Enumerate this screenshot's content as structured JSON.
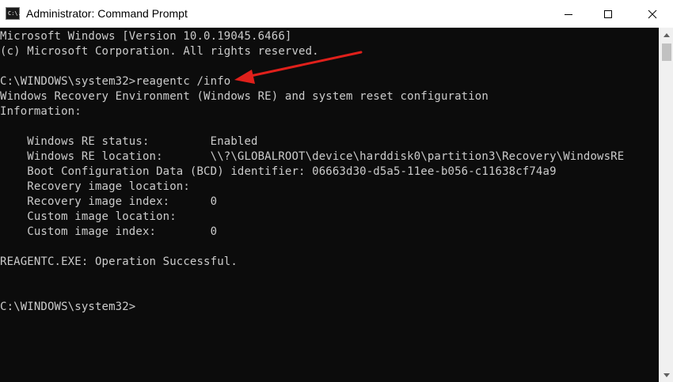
{
  "window": {
    "title": "Administrator: Command Prompt",
    "icon_glyph": "C:\\."
  },
  "console": {
    "lines": [
      "Microsoft Windows [Version 10.0.19045.6466]",
      "(c) Microsoft Corporation. All rights reserved.",
      "",
      "C:\\WINDOWS\\system32>reagentc /info",
      "Windows Recovery Environment (Windows RE) and system reset configuration",
      "Information:",
      "",
      "    Windows RE status:         Enabled",
      "    Windows RE location:       \\\\?\\GLOBALROOT\\device\\harddisk0\\partition3\\Recovery\\WindowsRE",
      "    Boot Configuration Data (BCD) identifier: 06663d30-d5a5-11ee-b056-c11638cf74a9",
      "    Recovery image location:",
      "    Recovery image index:      0",
      "    Custom image location:",
      "    Custom image index:        0",
      "",
      "REAGENTC.EXE: Operation Successful.",
      "",
      "",
      "C:\\WINDOWS\\system32>"
    ]
  },
  "colors": {
    "console_bg": "#0c0c0c",
    "console_text": "#cccccc",
    "annotation_arrow": "#e0201b"
  },
  "icons": {
    "minimize": "minimize-icon",
    "maximize": "maximize-icon",
    "close": "close-icon"
  }
}
